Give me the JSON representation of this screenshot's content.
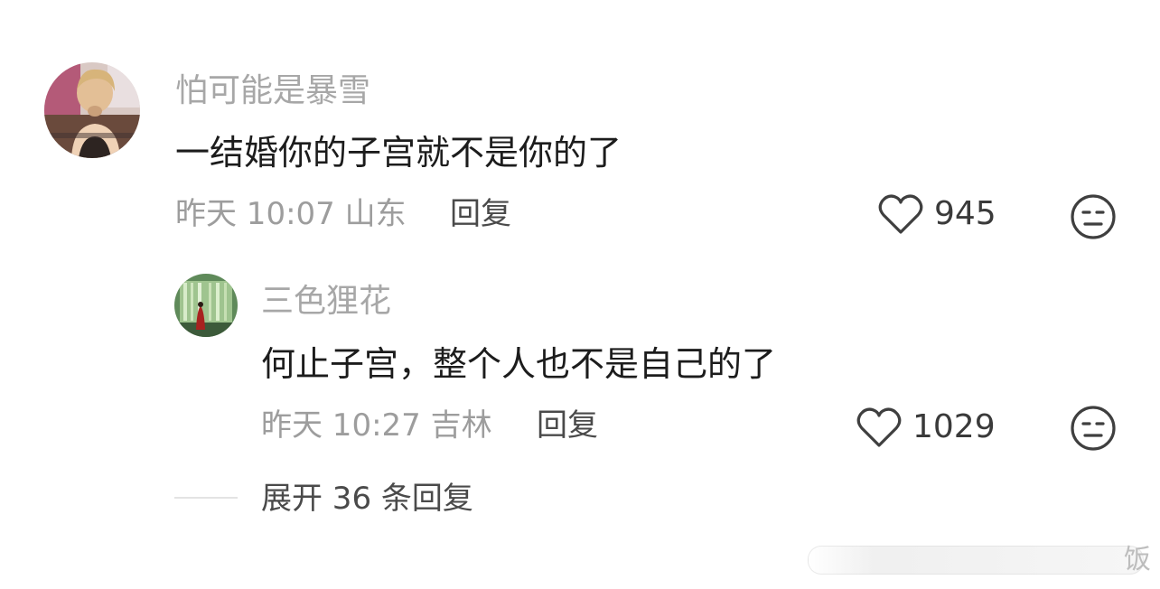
{
  "comments": [
    {
      "username": "怕可能是暴雪",
      "content": "一结婚你的子宫就不是你的了",
      "meta": "昨天 10:07 山东",
      "reply_label": "回复",
      "likes": "945"
    }
  ],
  "replies": [
    {
      "username": "三色狸花",
      "content": "何止子宫，整个人也不是自己的了",
      "meta": "昨天 10:27 吉林",
      "reply_label": "回复",
      "likes": "1029"
    }
  ],
  "expand_label": "展开 36 条回复",
  "watermark": "饭",
  "icons": {
    "like": "heart-outline-icon",
    "dislike": "unhappy-face-icon"
  },
  "colors": {
    "username": "#a7a7a7",
    "content": "#1c1c1c",
    "meta": "#9d9d9d",
    "action": "#4a4a4a"
  }
}
